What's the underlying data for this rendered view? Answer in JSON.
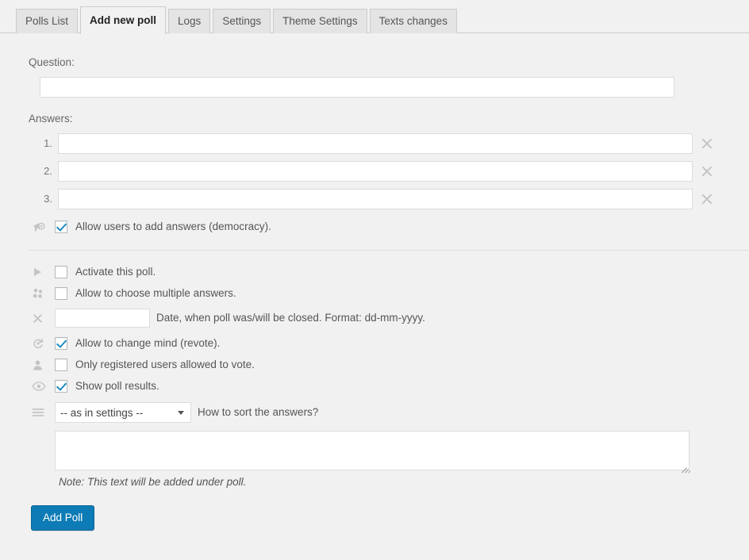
{
  "tabs": [
    {
      "label": "Polls List",
      "active": false
    },
    {
      "label": "Add new poll",
      "active": true
    },
    {
      "label": "Logs",
      "active": false
    },
    {
      "label": "Settings",
      "active": false
    },
    {
      "label": "Theme Settings",
      "active": false
    },
    {
      "label": "Texts changes",
      "active": false
    }
  ],
  "form": {
    "question_label": "Question:",
    "question_value": "",
    "question_placeholder": "",
    "answers_label": "Answers:",
    "answers": [
      {
        "number": "1.",
        "value": "",
        "remove_label": "×"
      },
      {
        "number": "2.",
        "value": "",
        "remove_label": "×"
      },
      {
        "number": "3.",
        "value": "",
        "remove_label": "×"
      }
    ],
    "democracy": {
      "icon": "megaphone-icon",
      "label": "Allow users to add answers (democracy).",
      "checked": true
    },
    "options": [
      {
        "icon": "play-triangle-icon",
        "label": "Activate this poll.",
        "checked": false
      },
      {
        "icon": "group-users-icon",
        "label": "Allow to choose multiple answers.",
        "checked": false
      }
    ],
    "close_date": {
      "icon": "x-mark-icon",
      "value": "",
      "hint": "Date, when poll was/will be closed. Format: dd-mm-yyyy."
    },
    "options2": [
      {
        "icon": "revote-circle-icon",
        "label": "Allow to change mind (revote).",
        "checked": true
      },
      {
        "icon": "person-icon",
        "label": "Only registered users allowed to vote.",
        "checked": false
      },
      {
        "icon": "eye-icon",
        "label": "Show poll results.",
        "checked": true
      }
    ],
    "sort": {
      "icon": "hamburger-lines-icon",
      "selected": "-- as in settings --",
      "options": [
        "-- as in settings --"
      ],
      "label": "How to sort the answers?"
    },
    "note_textarea_value": "",
    "note_text": "Note: This text will be added under poll.",
    "submit_label": "Add Poll"
  },
  "colors": {
    "accent": "#0d7bb5",
    "checkmark": "#1e8cbe",
    "background": "#f1f1f1",
    "icon_gray": "#c4c4c4"
  }
}
